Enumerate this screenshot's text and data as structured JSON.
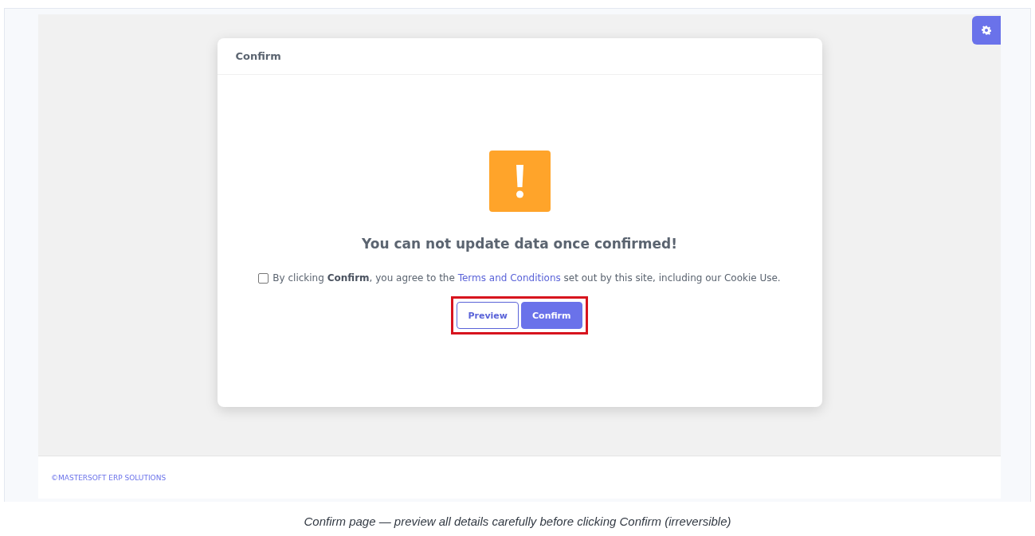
{
  "modal": {
    "title": "Confirm",
    "message": "You can not update data once confirmed!",
    "agreement": {
      "checked": false,
      "text_before": "By clicking **Confirm**, you agree to the",
      "link": "Terms and Conditions",
      "text_after": "set out by this site, including our Cookie Use."
    },
    "buttons": [
      {
        "label": "Preview",
        "kind": "outline"
      },
      {
        "label": "Confirm",
        "kind": "primary"
      }
    ]
  },
  "footer": {
    "copyright": "©MASTERSOFT ERP SOLUTIONS"
  },
  "caption": "Confirm page — preview all details carefully before clicking Confirm (irreversible)"
}
